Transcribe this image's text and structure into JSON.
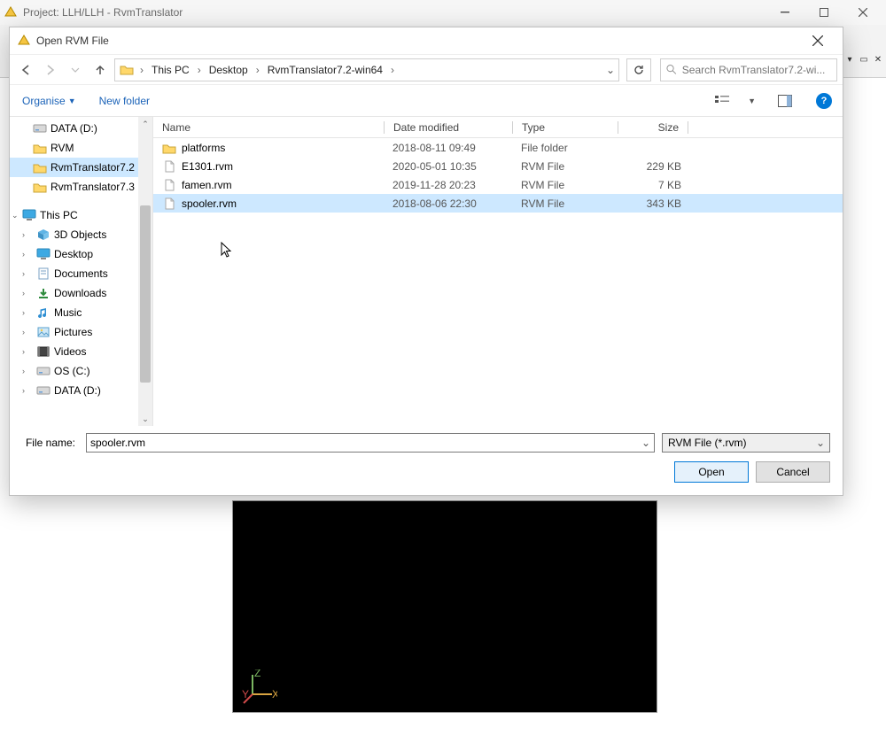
{
  "app": {
    "title": "Project: LLH/LLH - RvmTranslator"
  },
  "dialog": {
    "title": "Open RVM File",
    "breadcrumb": [
      "This PC",
      "Desktop",
      "RvmTranslator7.2-win64"
    ],
    "search_placeholder": "Search RvmTranslator7.2-wi...",
    "organise": "Organise",
    "newfolder": "New folder",
    "columns": {
      "name": "Name",
      "date": "Date modified",
      "type": "Type",
      "size": "Size"
    },
    "tree_top": [
      {
        "label": "DATA (D:)",
        "icon": "drive"
      },
      {
        "label": "RVM",
        "icon": "folder"
      },
      {
        "label": "RvmTranslator7.2",
        "icon": "folder",
        "selected": true
      },
      {
        "label": "RvmTranslator7.3",
        "icon": "folder"
      }
    ],
    "tree_pc_label": "This PC",
    "tree_pc": [
      {
        "label": "3D Objects",
        "icon": "cube"
      },
      {
        "label": "Desktop",
        "icon": "desktop"
      },
      {
        "label": "Documents",
        "icon": "doc"
      },
      {
        "label": "Downloads",
        "icon": "download"
      },
      {
        "label": "Music",
        "icon": "music"
      },
      {
        "label": "Pictures",
        "icon": "pic"
      },
      {
        "label": "Videos",
        "icon": "video"
      },
      {
        "label": "OS (C:)",
        "icon": "drive"
      },
      {
        "label": "DATA (D:)",
        "icon": "drive"
      }
    ],
    "files": [
      {
        "name": "platforms",
        "date": "2018-08-11 09:49",
        "type": "File folder",
        "size": "",
        "kind": "folder"
      },
      {
        "name": "E1301.rvm",
        "date": "2020-05-01 10:35",
        "type": "RVM File",
        "size": "229 KB",
        "kind": "file"
      },
      {
        "name": "famen.rvm",
        "date": "2019-11-28 20:23",
        "type": "RVM File",
        "size": "7 KB",
        "kind": "file"
      },
      {
        "name": "spooler.rvm",
        "date": "2018-08-06 22:30",
        "type": "RVM File",
        "size": "343 KB",
        "kind": "file",
        "selected": true
      }
    ],
    "file_name_label": "File name:",
    "file_name_value": "spooler.rvm",
    "filter": "RVM File (*.rvm)",
    "open": "Open",
    "cancel": "Cancel"
  },
  "viewport": {
    "axis": {
      "x": "X",
      "y": "Y",
      "z": "Z"
    }
  }
}
